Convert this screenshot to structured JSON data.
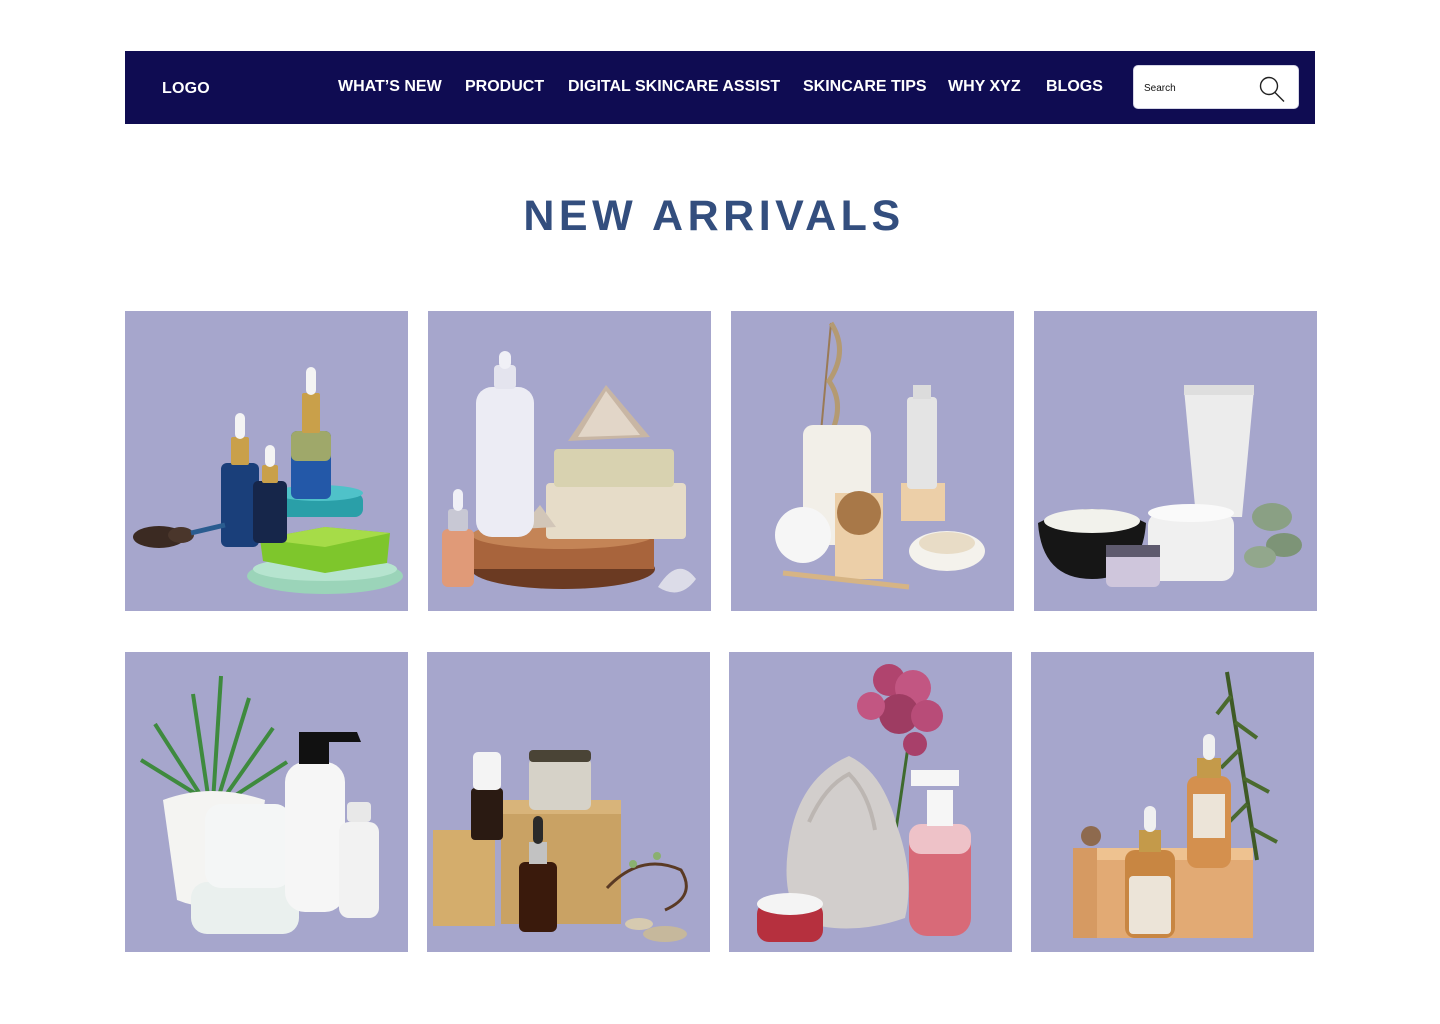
{
  "header": {
    "logo": "LOGO",
    "nav": [
      {
        "label": "WHAT’S NEW"
      },
      {
        "label": "PRODUCT"
      },
      {
        "label": "DIGITAL SKINCARE ASSIST"
      },
      {
        "label": "SKINCARE TIPS"
      },
      {
        "label": "WHY XYZ"
      },
      {
        "label": "BLOGS"
      }
    ],
    "search": {
      "placeholder": "Search",
      "icon": "search-icon"
    }
  },
  "main": {
    "title": "NEW ARRIVALS",
    "products": [
      {
        "image": "serum-bottles-soap-image"
      },
      {
        "image": "dropper-bottles-seashells-image"
      },
      {
        "image": "tube-cubes-toothbrush-image"
      },
      {
        "image": "tube-jars-salt-bowl-image"
      },
      {
        "image": "plant-pump-bottle-jars-image"
      },
      {
        "image": "amber-bottles-wood-blocks-image"
      },
      {
        "image": "flower-stone-pump-bottle-image"
      },
      {
        "image": "serum-bottles-wood-box-image"
      }
    ]
  },
  "colors": {
    "navbar": "#0f0c52",
    "title": "#334e7e",
    "card_background": "#a6a6cc"
  }
}
